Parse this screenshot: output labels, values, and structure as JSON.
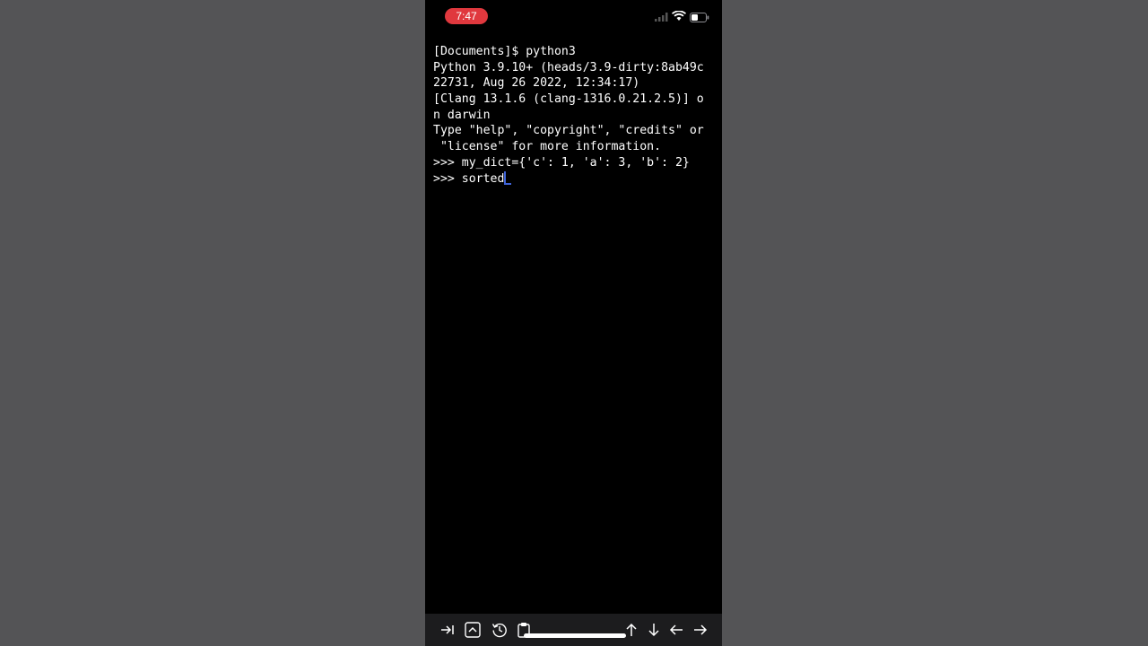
{
  "status_bar": {
    "time": "7:47",
    "icons": [
      "signal-icon",
      "wifi-icon",
      "battery-icon"
    ]
  },
  "terminal": {
    "lines": [
      "[Documents]$ python3",
      "Python 3.9.10+ (heads/3.9-dirty:8ab49c",
      "22731, Aug 26 2022, 12:34:17)",
      "[Clang 13.1.6 (clang-1316.0.21.2.5)] o",
      "n darwin",
      "Type \"help\", \"copyright\", \"credits\" or",
      " \"license\" for more information.",
      ">>> my_dict={'c': 1, 'a': 3, 'b': 2}",
      ">>> sorted"
    ]
  },
  "toolbar": {
    "buttons": [
      "tab-icon",
      "control-icon",
      "history-icon",
      "paste-icon",
      "arrow-up-icon",
      "arrow-down-icon",
      "arrow-left-icon",
      "arrow-right-icon"
    ]
  },
  "colors": {
    "background": "#545456",
    "terminal_bg": "#000000",
    "time_pill": "#e0383e",
    "cursor": "#3f63d6",
    "toolbar_bg": "#1c1c1e"
  }
}
